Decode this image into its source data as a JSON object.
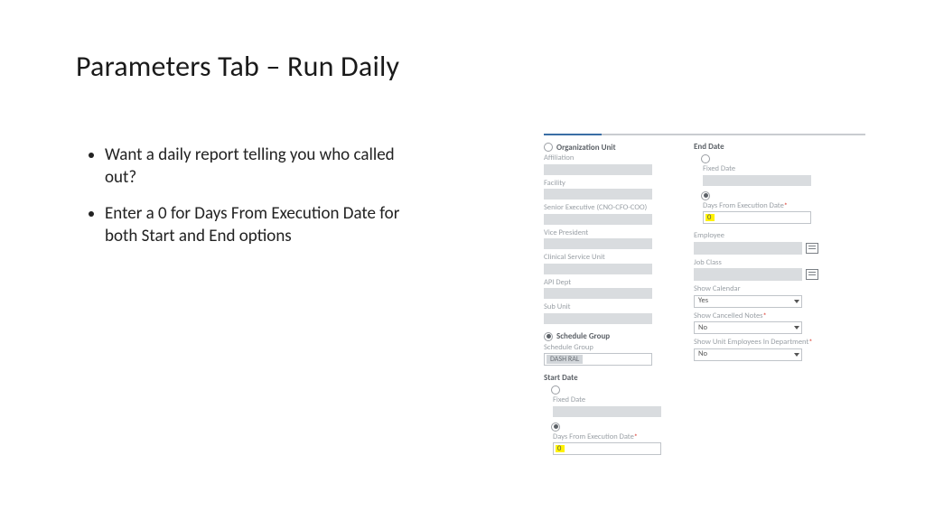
{
  "slide": {
    "title": "Parameters Tab – Run Daily",
    "bullets": [
      "Want a daily report telling you who called out?",
      "Enter a 0 for Days From Execution Date for both Start and End options"
    ]
  },
  "form": {
    "left": {
      "org_unit": {
        "header": "Organization Unit",
        "affiliation": "Affiliation",
        "facility": "Facility",
        "senior_exec": "Senior Executive (CNO-CFO-COO)",
        "vp": "Vice President",
        "clinical": "Clinical Service Unit",
        "api": "API Dept",
        "sub": "Sub Unit"
      },
      "schedule_group": {
        "header": "Schedule Group",
        "label": "Schedule Group",
        "pill": "DASH RAL"
      },
      "start_date": {
        "header": "Start Date",
        "fixed": "Fixed Date",
        "days_from": "Days From Execution Date",
        "days_from_value": "0"
      }
    },
    "right": {
      "end_date": {
        "header": "End Date",
        "fixed": "Fixed Date",
        "days_from": "Days From Execution Date",
        "days_from_value": "0"
      },
      "employee": "Employee",
      "job_class": "Job Class",
      "show_calendar": {
        "label": "Show Calendar",
        "value": "Yes"
      },
      "show_cancelled": {
        "label": "Show Cancelled Notes",
        "value": "No"
      },
      "show_unit_emp": {
        "label": "Show Unit Employees In Department",
        "value": "No"
      }
    },
    "required_mark": "*"
  }
}
